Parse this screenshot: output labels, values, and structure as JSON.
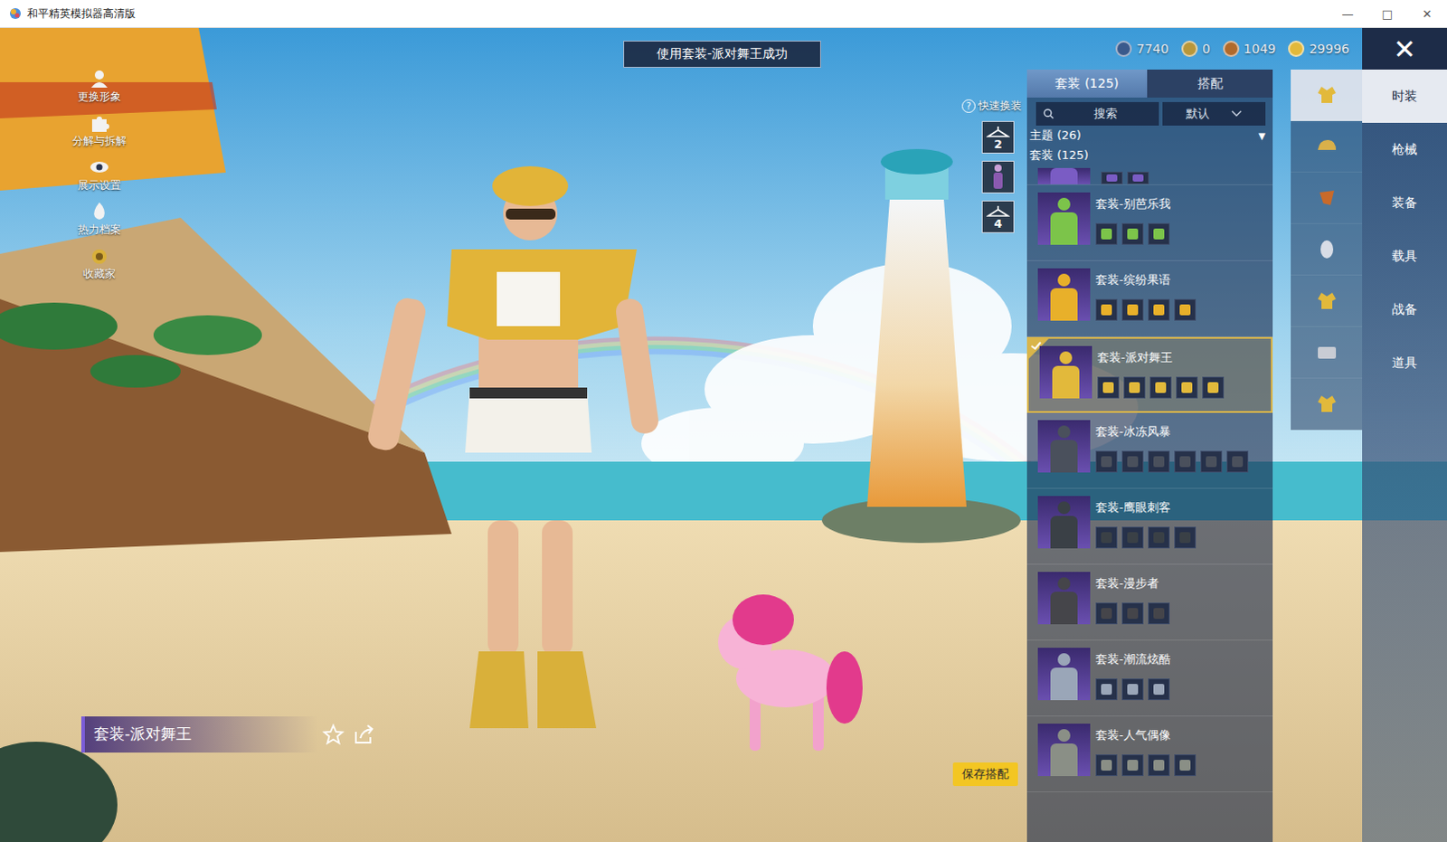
{
  "window": {
    "title": "和平精英模拟器高清版",
    "controls": [
      "—",
      "□",
      "✕"
    ]
  },
  "toast": "使用套装-派对舞王成功",
  "currencies": [
    {
      "amount": "7740",
      "color": "#3a5a8c"
    },
    {
      "amount": "0",
      "color": "#b8973a"
    },
    {
      "amount": "1049",
      "color": "#b06a2c"
    },
    {
      "amount": "29996",
      "color": "#e2b93b"
    }
  ],
  "close_button": "✕",
  "left_menu": [
    {
      "label": "更换形象"
    },
    {
      "label": "分解与拆解"
    },
    {
      "label": "展示设置"
    },
    {
      "label": "热力档案"
    },
    {
      "label": "收藏家"
    }
  ],
  "quick_change": {
    "label": "快速换装",
    "help": "?",
    "slots": [
      {
        "kind": "numbered",
        "number": "2"
      },
      {
        "kind": "figure"
      },
      {
        "kind": "numbered",
        "number": "4"
      }
    ]
  },
  "suit_panel": {
    "tabs": [
      {
        "label": "套装 (125)",
        "selected": true
      },
      {
        "label": "搭配",
        "selected": false
      }
    ],
    "search": {
      "placeholder": "搜索"
    },
    "sort": {
      "value": "默认"
    },
    "theme_filter": {
      "label": "主题 (26)",
      "arrow": "▼"
    },
    "section": "套装 (125)",
    "items": [
      {
        "kind": "partial",
        "pieces": 2,
        "color": "#7a5cc4",
        "selected": false
      },
      {
        "kind": "full",
        "name": "套装-别芭乐我",
        "pieces": 3,
        "color": "#7cc44a",
        "selected": false
      },
      {
        "kind": "full",
        "name": "套装-缤纷果语",
        "pieces": 4,
        "color": "#e8b02a",
        "selected": false
      },
      {
        "kind": "full",
        "name": "套装-派对舞王",
        "pieces": 5,
        "color": "#e2b93b",
        "selected": true
      },
      {
        "kind": "full",
        "name": "套装-冰冻风暴",
        "pieces": 6,
        "color": "#4a505c",
        "selected": false
      },
      {
        "kind": "full",
        "name": "套装-鹰眼刺客",
        "pieces": 4,
        "color": "#3a4046",
        "selected": false
      },
      {
        "kind": "full",
        "name": "套装-漫步者",
        "pieces": 3,
        "color": "#45454a",
        "selected": false
      },
      {
        "kind": "full",
        "name": "套装-潮流炫酷",
        "pieces": 3,
        "color": "#9aa6b8",
        "selected": false
      },
      {
        "kind": "full",
        "name": "套装-人气偶像",
        "pieces": 4,
        "color": "#8a8f86",
        "selected": false
      }
    ]
  },
  "categories": [
    {
      "selected": true
    },
    {
      "selected": false
    },
    {
      "selected": false
    },
    {
      "selected": false
    },
    {
      "selected": false
    },
    {
      "selected": false
    },
    {
      "selected": false
    }
  ],
  "nav": [
    {
      "label": "时装",
      "selected": true
    },
    {
      "label": "枪械",
      "selected": false
    },
    {
      "label": "装备",
      "selected": false
    },
    {
      "label": "载具",
      "selected": false
    },
    {
      "label": "战备",
      "selected": false
    },
    {
      "label": "道具",
      "selected": false
    }
  ],
  "outfit_label": "套装-派对舞王",
  "save_button": "保存搭配"
}
